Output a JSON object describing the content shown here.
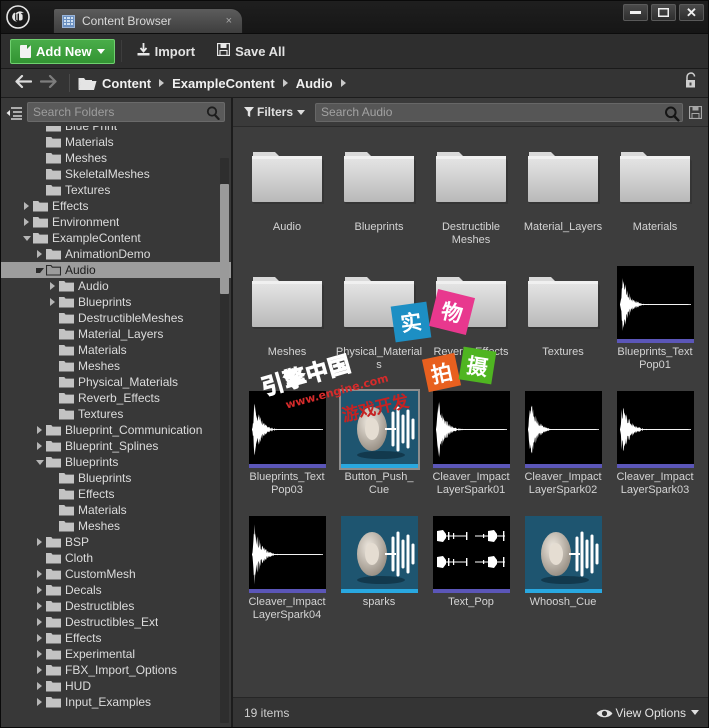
{
  "window": {
    "logo_name": "unreal-engine-logo",
    "tab_label": "Content Browser",
    "tab_close_label": "×",
    "controls": {
      "minimize": "—",
      "maximize": "▢",
      "close": "✕"
    }
  },
  "toolbar": {
    "add_new_label": "Add New",
    "import_label": "Import",
    "save_all_label": "Save All"
  },
  "breadcrumb": {
    "back_label": "←",
    "forward_label": "→",
    "items": [
      "Content",
      "ExampleContent",
      "Audio"
    ],
    "lock_icon": "unlocked-padlock-icon"
  },
  "sidebar": {
    "search_placeholder": "Search Folders",
    "tree": [
      {
        "label": "Blue Print",
        "depth": 2,
        "disc": "none",
        "partial": true
      },
      {
        "label": "Materials",
        "depth": 2,
        "disc": "none"
      },
      {
        "label": "Meshes",
        "depth": 2,
        "disc": "none"
      },
      {
        "label": "SkeletalMeshes",
        "depth": 2,
        "disc": "none"
      },
      {
        "label": "Textures",
        "depth": 2,
        "disc": "none"
      },
      {
        "label": "Effects",
        "depth": 1,
        "disc": "closed"
      },
      {
        "label": "Environment",
        "depth": 1,
        "disc": "closed"
      },
      {
        "label": "ExampleContent",
        "depth": 1,
        "disc": "open"
      },
      {
        "label": "AnimationDemo",
        "depth": 2,
        "disc": "closed"
      },
      {
        "label": "Audio",
        "depth": 2,
        "disc": "open",
        "selected": true
      },
      {
        "label": "Audio",
        "depth": 3,
        "disc": "closed"
      },
      {
        "label": "Blueprints",
        "depth": 3,
        "disc": "closed"
      },
      {
        "label": "DestructibleMeshes",
        "depth": 3,
        "disc": "none"
      },
      {
        "label": "Material_Layers",
        "depth": 3,
        "disc": "none"
      },
      {
        "label": "Materials",
        "depth": 3,
        "disc": "none"
      },
      {
        "label": "Meshes",
        "depth": 3,
        "disc": "none"
      },
      {
        "label": "Physical_Materials",
        "depth": 3,
        "disc": "none"
      },
      {
        "label": "Reverb_Effects",
        "depth": 3,
        "disc": "none"
      },
      {
        "label": "Textures",
        "depth": 3,
        "disc": "none"
      },
      {
        "label": "Blueprint_Communication",
        "depth": 2,
        "disc": "closed"
      },
      {
        "label": "Blueprint_Splines",
        "depth": 2,
        "disc": "closed"
      },
      {
        "label": "Blueprints",
        "depth": 2,
        "disc": "open"
      },
      {
        "label": "Blueprints",
        "depth": 3,
        "disc": "none"
      },
      {
        "label": "Effects",
        "depth": 3,
        "disc": "none"
      },
      {
        "label": "Materials",
        "depth": 3,
        "disc": "none"
      },
      {
        "label": "Meshes",
        "depth": 3,
        "disc": "none"
      },
      {
        "label": "BSP",
        "depth": 2,
        "disc": "closed"
      },
      {
        "label": "Cloth",
        "depth": 2,
        "disc": "none"
      },
      {
        "label": "CustomMesh",
        "depth": 2,
        "disc": "closed"
      },
      {
        "label": "Decals",
        "depth": 2,
        "disc": "closed"
      },
      {
        "label": "Destructibles",
        "depth": 2,
        "disc": "closed"
      },
      {
        "label": "Destructibles_Ext",
        "depth": 2,
        "disc": "closed"
      },
      {
        "label": "Effects",
        "depth": 2,
        "disc": "closed"
      },
      {
        "label": "Experimental",
        "depth": 2,
        "disc": "closed"
      },
      {
        "label": "FBX_Import_Options",
        "depth": 2,
        "disc": "closed"
      },
      {
        "label": "HUD",
        "depth": 2,
        "disc": "closed"
      },
      {
        "label": "Input_Examples",
        "depth": 2,
        "disc": "closed"
      }
    ]
  },
  "content": {
    "filters_label": "Filters",
    "search_placeholder": "Search Audio",
    "items": [
      {
        "label": "Audio",
        "type": "folder"
      },
      {
        "label": "Blueprints",
        "type": "folder"
      },
      {
        "label": "Destructible Meshes",
        "type": "folder"
      },
      {
        "label": "Material_Layers",
        "type": "folder"
      },
      {
        "label": "Materials",
        "type": "folder"
      },
      {
        "label": "Meshes",
        "type": "folder"
      },
      {
        "label": "Physical_Materials",
        "type": "folder"
      },
      {
        "label": "Reverb_Effects",
        "type": "folder"
      },
      {
        "label": "Textures",
        "type": "folder"
      },
      {
        "label": "Blueprints_Text Pop01",
        "type": "wave"
      },
      {
        "label": "Blueprints_Text Pop03",
        "type": "wave"
      },
      {
        "label": "Button_Push_ Cue",
        "type": "cue",
        "selected": true
      },
      {
        "label": "Cleaver_Impact LayerSpark01",
        "type": "wave"
      },
      {
        "label": "Cleaver_Impact LayerSpark02",
        "type": "wave"
      },
      {
        "label": "Cleaver_Impact LayerSpark03",
        "type": "wave"
      },
      {
        "label": "Cleaver_Impact LayerSpark04",
        "type": "wave"
      },
      {
        "label": "sparks",
        "type": "cue"
      },
      {
        "label": "Text_Pop",
        "type": "wave2"
      },
      {
        "label": "Whoosh_Cue",
        "type": "cue"
      }
    ]
  },
  "status": {
    "item_count": "19 items",
    "view_options_label": "View Options"
  },
  "watermark": {
    "shi": "实",
    "wu": "物",
    "pai": "拍",
    "she": "摄",
    "brand": "引擎中国",
    "url": "www.engine.com",
    "tagline": "游戏开发"
  },
  "colors": {
    "accent_green": "#3c9d3c",
    "wave_bar": "#5b56b8",
    "cue_bar": "#29a8e0",
    "cue_bg": "#1e5570",
    "selection": "#9c9c9c"
  }
}
